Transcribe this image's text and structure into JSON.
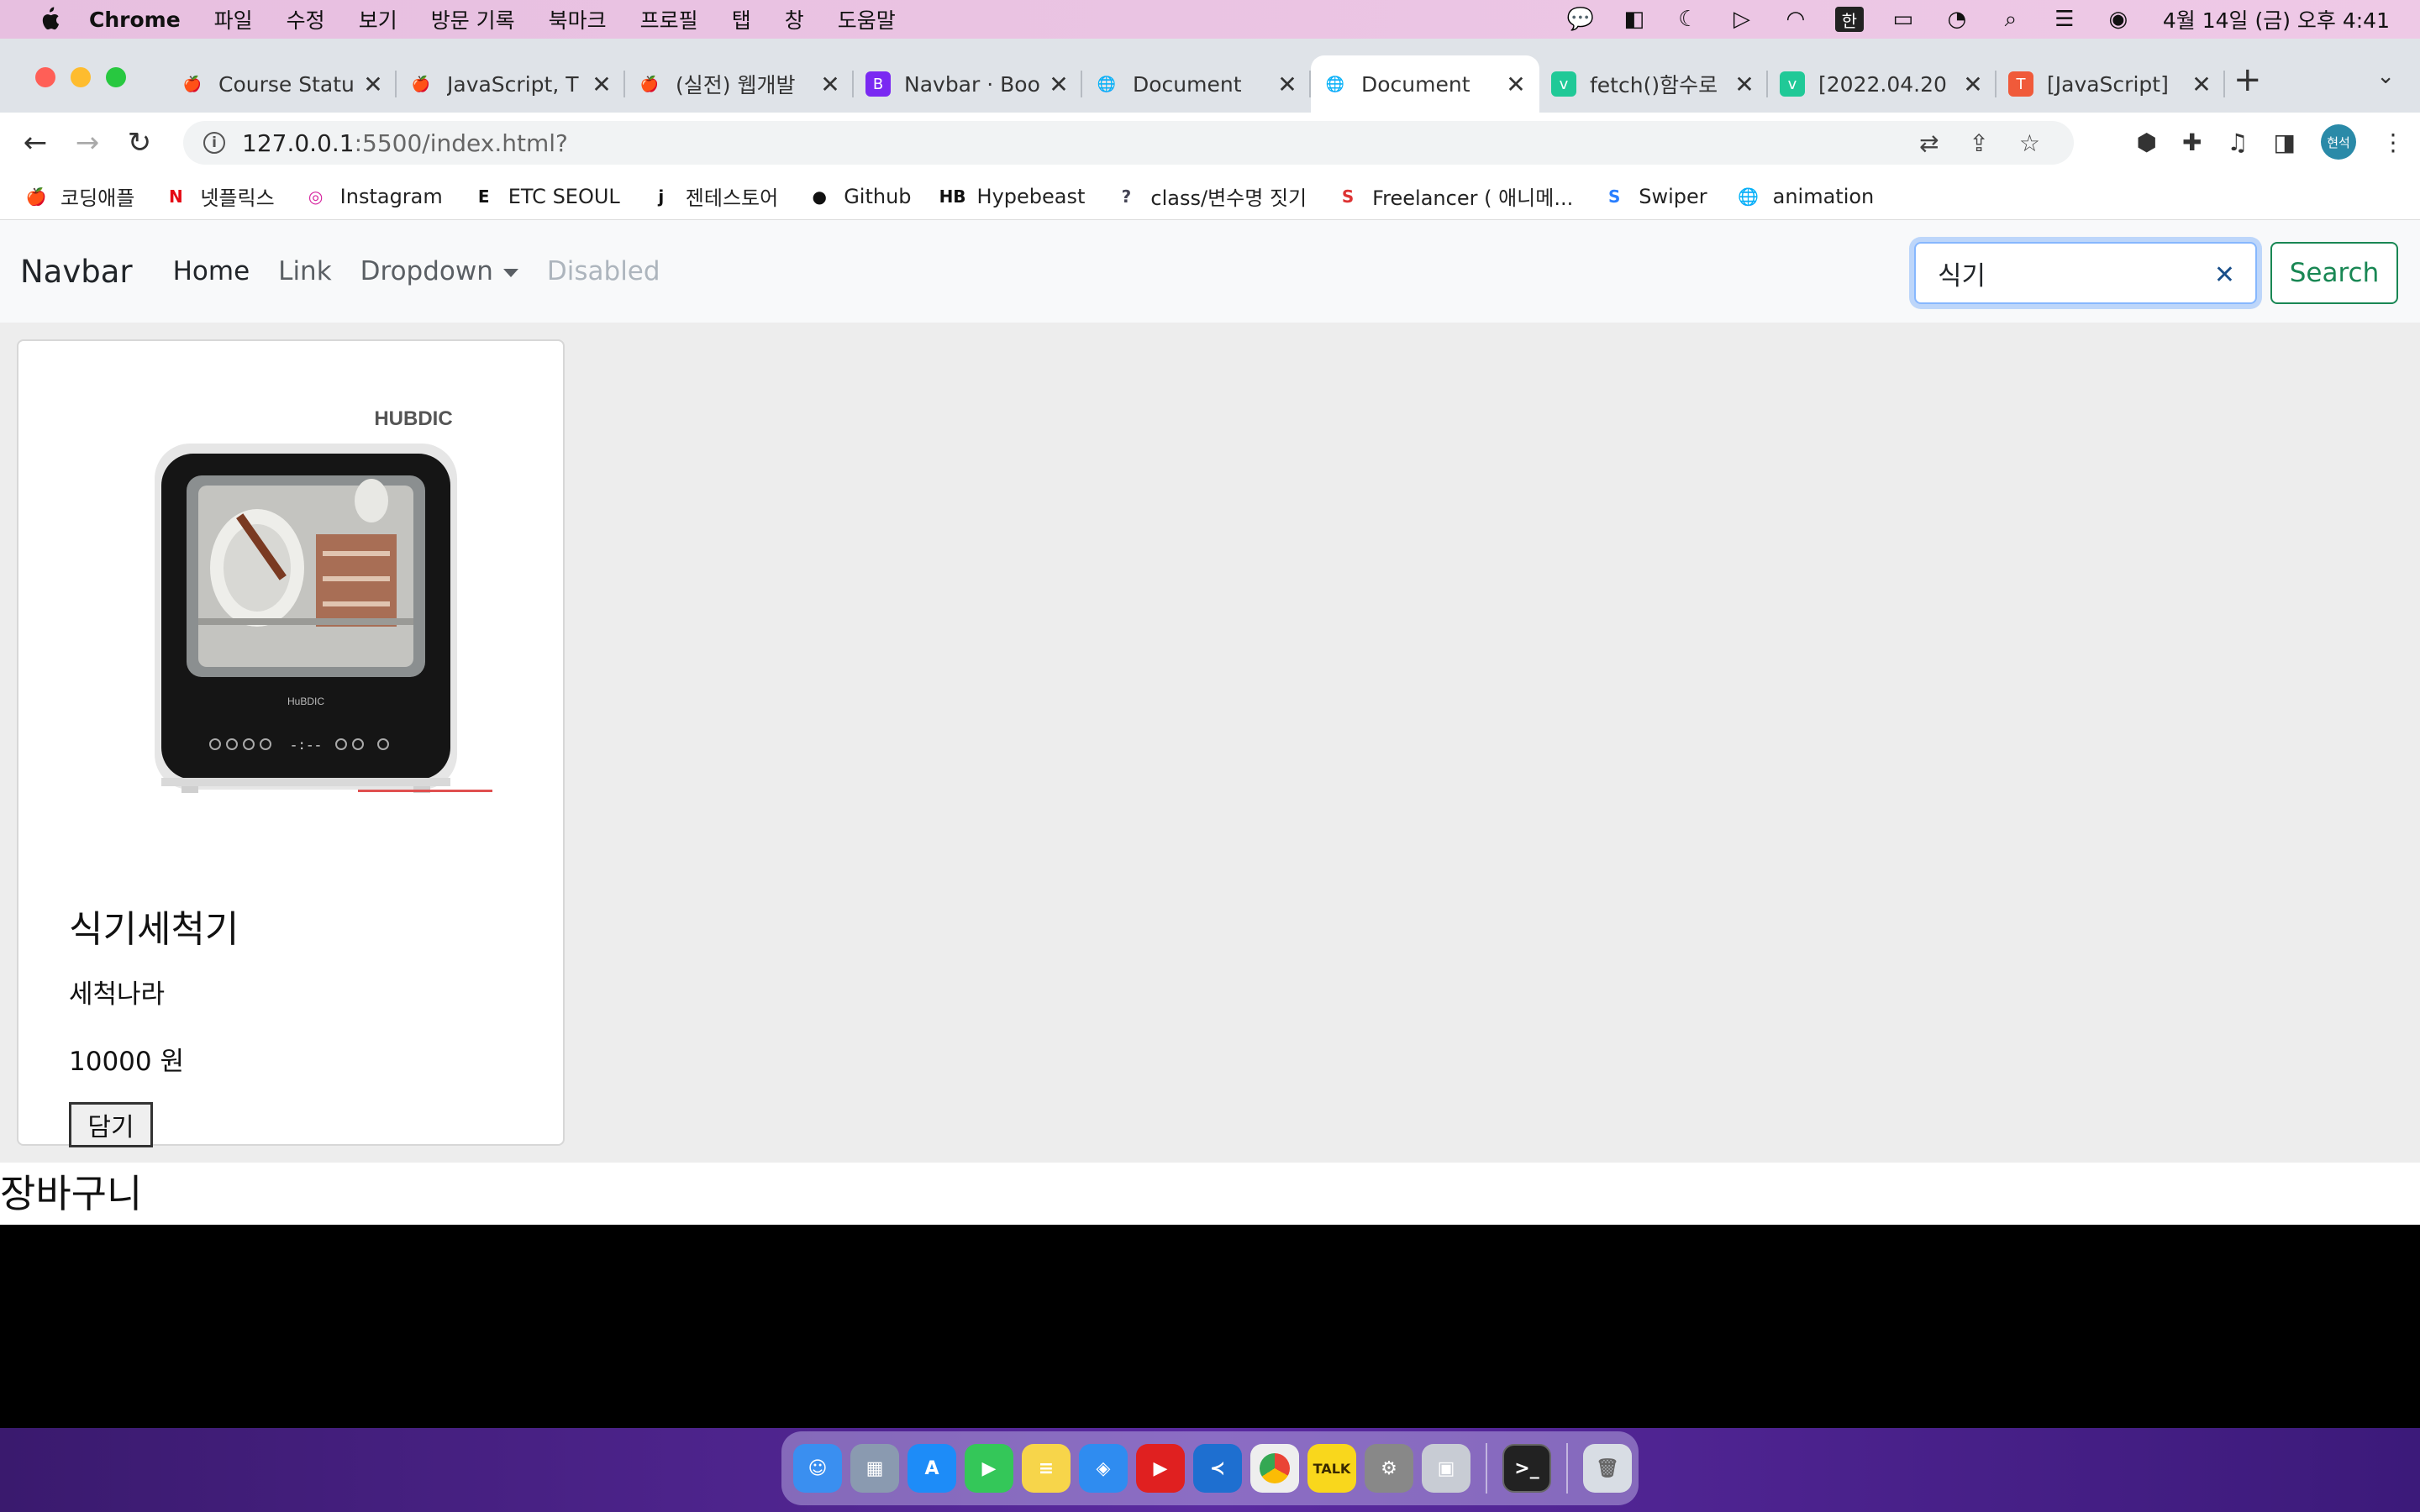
{
  "menubar": {
    "app_name": "Chrome",
    "items": [
      "파일",
      "수정",
      "보기",
      "방문 기록",
      "북마크",
      "프로필",
      "탭",
      "창",
      "도움말"
    ],
    "input_source": "한",
    "clock": "4월 14일 (금) 오후 4:41"
  },
  "tabs": [
    {
      "title": "Course Statu",
      "fav": "🍎",
      "fav_bg": "transparent"
    },
    {
      "title": "JavaScript, T",
      "fav": "🍎",
      "fav_bg": "transparent"
    },
    {
      "title": "(실전) 웹개발 ",
      "fav": "🍎",
      "fav_bg": "transparent"
    },
    {
      "title": "Navbar · Boo",
      "fav": "B",
      "fav_bg": "#7a29f2"
    },
    {
      "title": "Document",
      "fav": "🌐",
      "fav_bg": "transparent"
    },
    {
      "title": "Document",
      "fav": "🌐",
      "fav_bg": "transparent",
      "active": true
    },
    {
      "title": "fetch()함수로",
      "fav": "v",
      "fav_bg": "#20c997"
    },
    {
      "title": "[2022.04.20",
      "fav": "v",
      "fav_bg": "#20c997"
    },
    {
      "title": "[JavaScript]",
      "fav": "T",
      "fav_bg": "#f05a3a"
    }
  ],
  "address": {
    "host": "127.0.0.1",
    "path": ":5500/index.html?"
  },
  "bookmarks": [
    {
      "label": "코딩애플",
      "icon": "🍎",
      "color": "#d33"
    },
    {
      "label": "넷플릭스",
      "icon": "N",
      "color": "#e50914"
    },
    {
      "label": "Instagram",
      "icon": "◎",
      "color": "#d6249f"
    },
    {
      "label": "ETC SEOUL",
      "icon": "E",
      "color": "#111"
    },
    {
      "label": "젠테스토어",
      "icon": "j",
      "color": "#111"
    },
    {
      "label": "Github",
      "icon": "●",
      "color": "#111"
    },
    {
      "label": "Hypebeast",
      "icon": "HB",
      "color": "#111"
    },
    {
      "label": "class/변수명 짓기",
      "icon": "?",
      "color": "#445"
    },
    {
      "label": "Freelancer ( 애니메...",
      "icon": "S",
      "color": "#d33"
    },
    {
      "label": "Swiper",
      "icon": "S",
      "color": "#2a7fff"
    },
    {
      "label": "animation",
      "icon": "🌐",
      "color": "#555"
    }
  ],
  "navbar": {
    "brand": "Navbar",
    "links": [
      "Home",
      "Link",
      "Dropdown",
      "Disabled"
    ],
    "search_value": "식기",
    "search_button": "Search"
  },
  "product": {
    "title": "식기세척기",
    "seller": "세척나라",
    "price": "10000 원",
    "cart_button": "담기",
    "image_brand": "HUBDIC"
  },
  "cart": {
    "heading": "장바구니"
  },
  "colors": {
    "accent_success": "#198754",
    "focus_border": "#86b7fe"
  }
}
